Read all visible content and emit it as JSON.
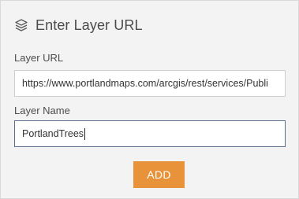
{
  "header": {
    "title": "Enter Layer URL",
    "icon": "layers-icon"
  },
  "form": {
    "layer_url": {
      "label": "Layer URL",
      "value": "https://www.portlandmaps.com/arcgis/rest/services/Publi"
    },
    "layer_name": {
      "label": "Layer Name",
      "value": "PortlandTrees"
    },
    "add_button_label": "ADD"
  },
  "colors": {
    "panel_background": "#f3f3f3",
    "add_button": "#e8933a",
    "focus_border": "#5b6f8f"
  }
}
